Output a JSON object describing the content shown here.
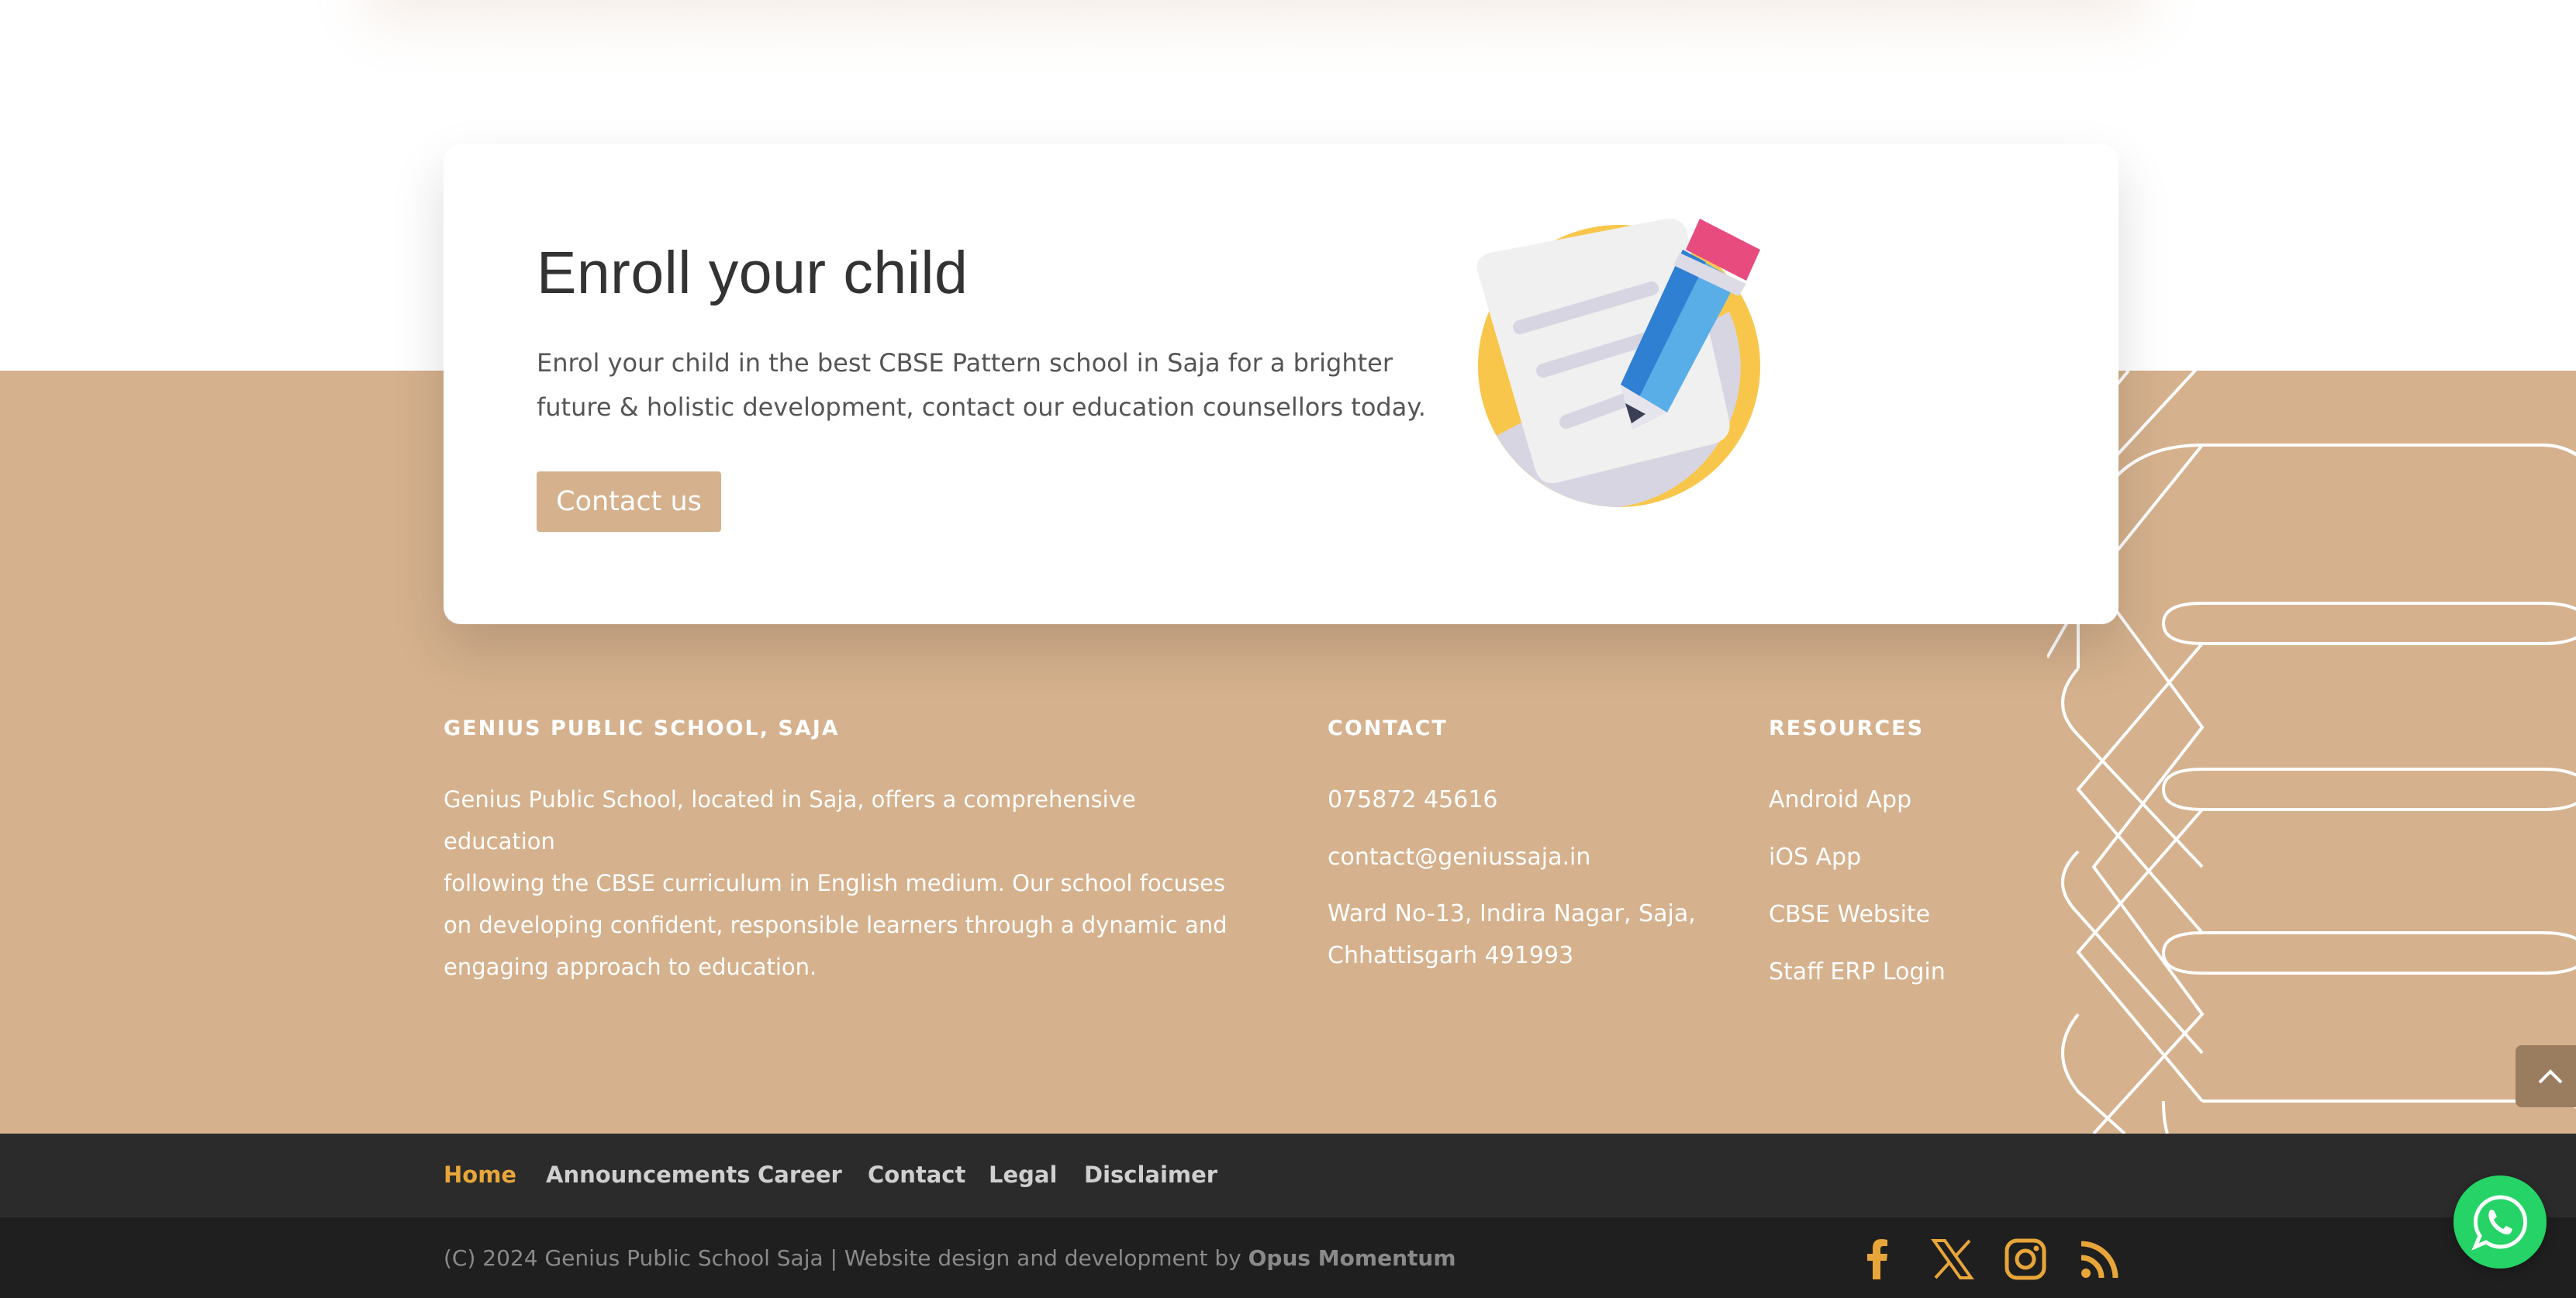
{
  "enroll": {
    "title": "Enroll your child",
    "text_line1": "Enrol your child in the best CBSE Pattern school in Saja for a brighter",
    "text_line2": "future & holistic development, contact our education counsellors today.",
    "button": "Contact us",
    "illustration": "pencil-notepad-icon"
  },
  "about": {
    "title": "GENIUS PUBLIC SCHOOL, SAJA",
    "lines": [
      "Genius Public School, located in Saja, offers a comprehensive education",
      "following the CBSE curriculum in English medium. Our school focuses",
      "on developing confident, responsible learners through a dynamic and",
      "engaging approach to education."
    ]
  },
  "contact": {
    "title": "CONTACT",
    "phone": "075872 45616",
    "email": "contact@geniussaja.in",
    "address_line1": "Ward No-13, Indira Nagar, Saja,",
    "address_line2": "Chhattisgarh 491993"
  },
  "resources": {
    "title": "RESOURCES",
    "items": [
      "Android App",
      "iOS App",
      "CBSE Website",
      "Staff ERP Login"
    ]
  },
  "nav": {
    "items": [
      "Home",
      "Announcements",
      "Career",
      "Contact",
      "Legal",
      "Disclaimer"
    ],
    "active": "Home"
  },
  "bottom": {
    "copyright": "(C) 2024 Genius Public School Saja | Website design and development by ",
    "credit": "Opus Momentum",
    "social_icons": [
      "facebook-icon",
      "x-icon",
      "instagram-icon",
      "rss-icon"
    ]
  },
  "colors": {
    "tan": "#d5b18d",
    "nav_bg": "#2b2b2b",
    "bottom_bg": "#1f1f1f",
    "accent": "#e8a63a",
    "whatsapp": "#25d366"
  },
  "widgets": {
    "scroll_top_icon": "chevron-up-icon",
    "chat_icon": "whatsapp-icon"
  }
}
